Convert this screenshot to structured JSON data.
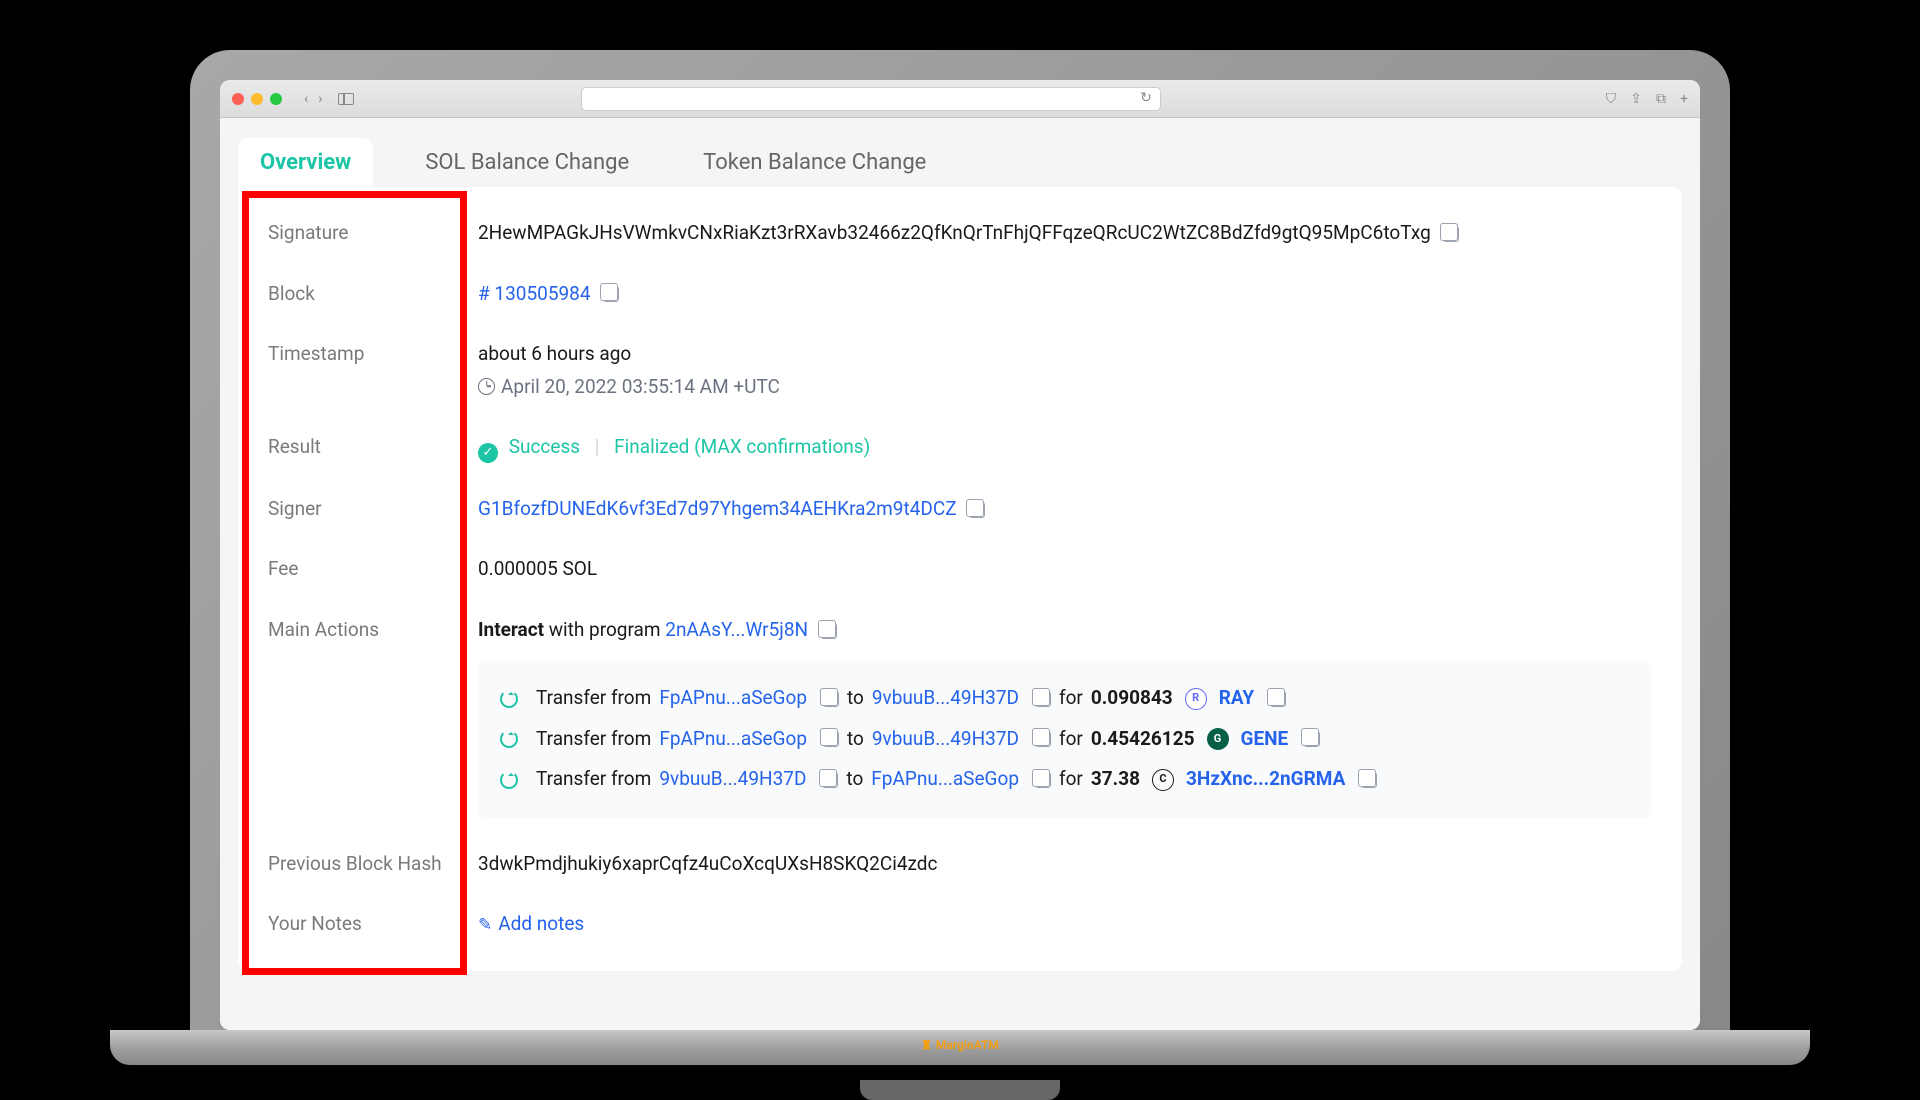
{
  "tabs": {
    "overview": "Overview",
    "sol_balance": "SOL Balance Change",
    "token_balance": "Token Balance Change"
  },
  "labels": {
    "signature": "Signature",
    "block": "Block",
    "timestamp": "Timestamp",
    "result": "Result",
    "signer": "Signer",
    "fee": "Fee",
    "main_actions": "Main Actions",
    "prev_block_hash": "Previous Block Hash",
    "your_notes": "Your Notes"
  },
  "tx": {
    "signature": "2HewMPAGkJHsVWmkvCNxRiaKzt3rRXavb32466z2QfKnQrTnFhjQFFqzeQRcUC2WtZC8BdZfd9gtQ95MpC6toTxg",
    "block_prefix": "# ",
    "block": "130505984",
    "timestamp_rel": "about 6 hours ago",
    "timestamp_abs": "April 20, 2022 03:55:14 AM +UTC",
    "result_status": "Success",
    "result_final": "Finalized (MAX confirmations)",
    "signer": "G1BfozfDUNEdK6vf3Ed7d97Yhgem34AEHKra2m9t4DCZ",
    "fee": "0.000005 SOL",
    "interact_prefix": "Interact",
    "interact_mid": " with program ",
    "program": "2nAAsY...Wr5j8N",
    "prev_hash": "3dwkPmdjhukiy6xaprCqfz4uCoXcqUXsH8SKQ2Ci4zdc",
    "add_notes": "Add notes"
  },
  "transfers": [
    {
      "from": "FpAPnu...aSeGop",
      "to": "9vbuuB...49H37D",
      "amount": "0.090843",
      "token": "RAY",
      "token_class": "icon-ray",
      "token_sym": "R"
    },
    {
      "from": "FpAPnu...aSeGop",
      "to": "9vbuuB...49H37D",
      "amount": "0.45426125",
      "token": "GENE",
      "token_class": "icon-gene",
      "token_sym": "G"
    },
    {
      "from": "9vbuuB...49H37D",
      "to": "FpAPnu...aSeGop",
      "amount": "37.38",
      "token": "3HzXnc...2nGRMA",
      "token_class": "icon-unknown",
      "token_sym": "C"
    }
  ],
  "words": {
    "transfer_from": "Transfer from ",
    "to": " to ",
    "for": " for "
  },
  "brand": "MarginATM"
}
